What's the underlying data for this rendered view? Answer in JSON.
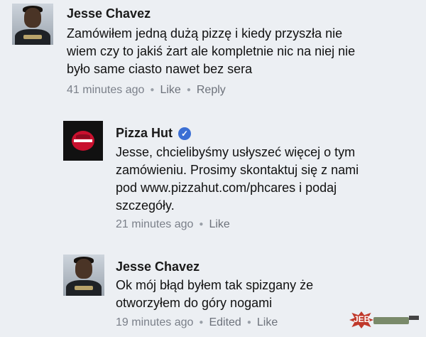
{
  "comments": [
    {
      "author": "Jesse Chavez",
      "lines": [
        "Zamówiłem jedną dużą pizzę i kiedy przyszła nie",
        "wiem czy to jakiś żart ale kompletnie nic na niej nie",
        "było same ciasto nawet bez sera"
      ],
      "time": "41 minutes ago",
      "actions": [
        "Like",
        "Reply"
      ]
    },
    {
      "author": "Pizza Hut",
      "verified": true,
      "lines": [
        "Jesse, chcielibyśmy usłyszeć więcej o tym",
        "zamówieniu. Prosimy skontaktuj się z nami",
        "pod www.pizzahut.com/phcares i podaj",
        "szczegóły."
      ],
      "time": "21 minutes ago",
      "actions": [
        "Like"
      ]
    },
    {
      "author": "Jesse Chavez",
      "lines": [
        "Ok mój błąd byłem tak spizgany że",
        "otworzyłem do góry nogami"
      ],
      "time": "19 minutes ago",
      "edited": "Edited",
      "actions": [
        "Like"
      ]
    }
  ],
  "watermark": {
    "text": "JEB"
  },
  "icons": {
    "verified": "verified-check-icon"
  }
}
